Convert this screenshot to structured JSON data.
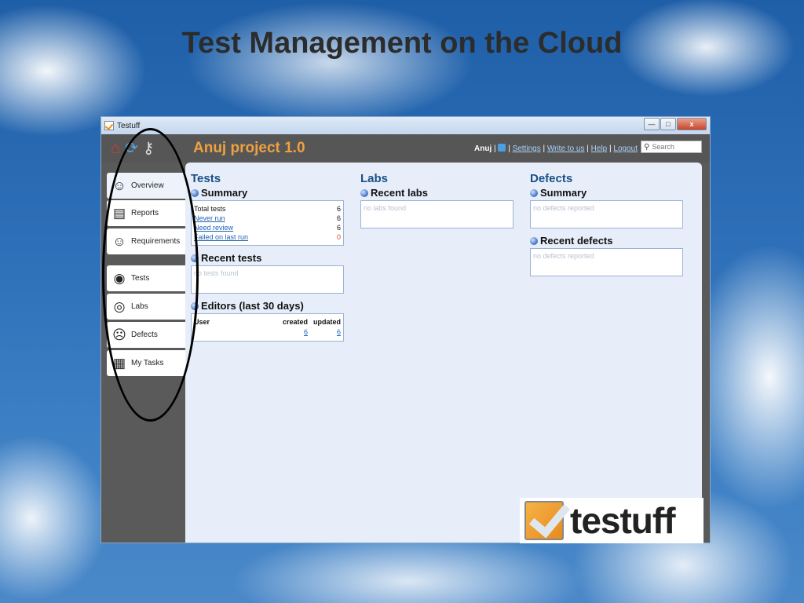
{
  "slide": {
    "title": "Test Management on the Cloud"
  },
  "window": {
    "title": "Testuff",
    "controls": {
      "minimize": "—",
      "maximize": "□",
      "close": "x"
    }
  },
  "header": {
    "project_title": "Anuj project 1.0",
    "user": "Anuj",
    "sep": "|",
    "links": {
      "settings": "Settings",
      "write": "Write to us",
      "help": "Help",
      "logout": "Logout"
    },
    "search_placeholder": "Search",
    "icons": [
      "home-icon",
      "refresh-icon",
      "key-icon"
    ]
  },
  "sidebar": {
    "items": [
      {
        "label": "Overview",
        "icon": "smiley-icon"
      },
      {
        "label": "Reports",
        "icon": "report-icon"
      },
      {
        "label": "Requirements",
        "icon": "smiley-icon"
      },
      {
        "label": "Tests",
        "icon": "monkey-icon"
      },
      {
        "label": "Labs",
        "icon": "glasses-icon"
      },
      {
        "label": "Defects",
        "icon": "surprised-icon"
      },
      {
        "label": "My Tasks",
        "icon": "clipboard-icon"
      }
    ]
  },
  "tests": {
    "heading": "Tests",
    "summary": {
      "heading": "Summary",
      "rows": [
        {
          "label": "Total tests",
          "value": "6"
        },
        {
          "label": "Never run",
          "value": "6"
        },
        {
          "label": "Need review",
          "value": "6"
        },
        {
          "label": "Failed on last run",
          "value": "0"
        }
      ]
    },
    "recent": {
      "heading": "Recent tests",
      "empty": "no tests found"
    },
    "editors": {
      "heading": "Editors (last 30 days)",
      "columns": {
        "user": "User",
        "created": "created",
        "updated": "updated"
      },
      "row": {
        "user": "",
        "created": "6",
        "updated": "6"
      }
    }
  },
  "labs": {
    "heading": "Labs",
    "recent": {
      "heading": "Recent labs",
      "empty": "no labs found"
    }
  },
  "defects": {
    "heading": "Defects",
    "summary": {
      "heading": "Summary",
      "empty": "no defects reported"
    },
    "recent": {
      "heading": "Recent defects",
      "empty": "no defects reported"
    }
  },
  "logo": {
    "text": "testuff"
  },
  "colors": {
    "accent_orange": "#f0a040",
    "heading_blue": "#1a4f86",
    "link_blue": "#1f62b4",
    "panel_bg": "#e7eef9"
  }
}
